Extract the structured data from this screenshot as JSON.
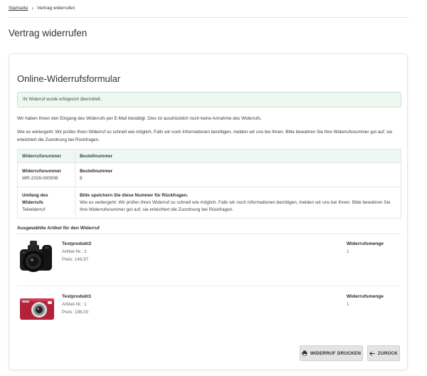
{
  "breadcrumb": {
    "home": "Startseite",
    "current": "Vertrag widerrufen"
  },
  "page_title": "Vertrag widerrufen",
  "form": {
    "title": "Online-Widerrufsformular",
    "success_message": "Ihr Widerruf wurde erfolgreich übermittelt.",
    "paragraph_1": "Wir haben Ihnen den Eingang des Widerrufs per E-Mail bestätigt. Dies ist ausdrücklich noch keine Annahme des Widerrufs.",
    "paragraph_2": "Wie es weitergeht: Wir prüfen Ihren Widerruf so schnell wie möglich. Falls wir noch Informationen benötigen, melden wir uns bei Ihnen. Bitte bewahren Sie Ihre Widerrufsnummer gut auf; sie erleichtert die Zuordnung bei Rückfragen."
  },
  "info_table": {
    "headers": [
      "Widerrufsnummer",
      "Bestellnummer"
    ],
    "row1": {
      "label": "Widerrufsnummer",
      "value": "WR-2026-000008",
      "label2": "Bestellnummer",
      "value2": "8"
    },
    "row2": {
      "label": "Umfang des Widerrufs",
      "value": "Teilwiderruf",
      "note_title": "Bitte speichern Sie diese Nummer für Rückfragen.",
      "note_text": "Wie es weitergeht: Wir prüfen Ihren Widerruf so schnell wie möglich. Falls wir noch Informationen benötigen, melden wir uns bei Ihnen. Bitte bewahren Sie Ihre Widerrufsnummer gut auf; sie erleichtert die Zuordnung bei Rückfragen."
    }
  },
  "articles_section_title": "Ausgewählte Artikel für den Widerruf",
  "articles": [
    {
      "name": "Testprodukt2",
      "article_no": "Artikel-Nr.: 2",
      "price": "Preis: 149,97",
      "qty_label": "Widerrufsmenge",
      "qty": "1",
      "image": "black-camera"
    },
    {
      "name": "Testprodukt1",
      "article_no": "Artikel-Nr.: 1",
      "price": "Preis: 198,00",
      "qty_label": "Widerrufsmenge",
      "qty": "1",
      "image": "red-compact-camera"
    }
  ],
  "buttons": {
    "print": "WIDERRUF DRUCKEN",
    "back": "ZURÜCK",
    "print_icon": "printer-icon",
    "back_icon": "arrow-left-icon"
  },
  "colors": {
    "alert_bg": "#eef7f1",
    "table_header_bg": "#eef7f2",
    "button_bg": "#e4e4e4"
  }
}
